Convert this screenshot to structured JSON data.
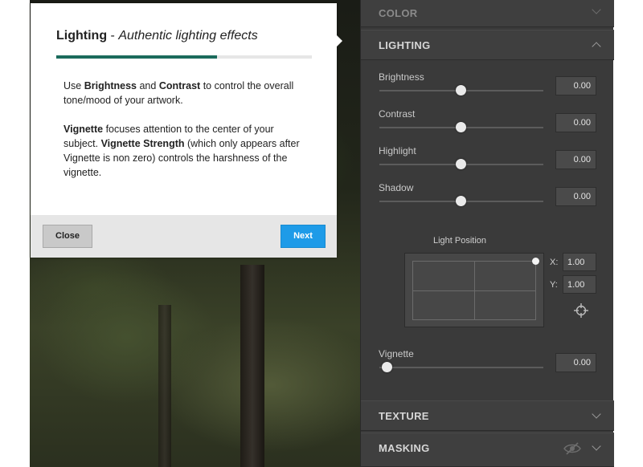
{
  "popover": {
    "title_bold": "Lighting",
    "title_sep": " - ",
    "title_italic": "Authentic lighting effects",
    "progress_fraction": 0.63,
    "p1": {
      "t1": "Use ",
      "b1": "Brightness",
      "t2": " and ",
      "b2": "Contrast",
      "t3": " to control the overall tone/mood of your artwork."
    },
    "p2": {
      "b1": "Vignette",
      "t1": " focuses attention to the center of your subject. ",
      "b2": "Vignette Strength",
      "t2": " (which only appears after Vignette is non zero) controls the harshness of the vignette."
    },
    "close_label": "Close",
    "next_label": "Next"
  },
  "panel": {
    "color_section": "COLOR",
    "lighting_section": "LIGHTING",
    "texture_section": "TEXTURE",
    "masking_section": "MASKING",
    "sliders": [
      {
        "label": "Brightness",
        "value": "0.00",
        "fraction": 0.5
      },
      {
        "label": "Contrast",
        "value": "0.00",
        "fraction": 0.5
      },
      {
        "label": "Highlight",
        "value": "0.00",
        "fraction": 0.5
      },
      {
        "label": "Shadow",
        "value": "0.00",
        "fraction": 0.5
      }
    ],
    "light_position": {
      "title": "Light Position",
      "x_label": "X:",
      "x_value": "1.00",
      "y_label": "Y:",
      "y_value": "1.00"
    },
    "vignette": {
      "label": "Vignette",
      "value": "0.00",
      "fraction": 0.0
    }
  },
  "icons": {
    "crosshair": "crosshair-icon",
    "visibility": "eye-slash-icon"
  },
  "colors": {
    "accent_progress": "#1b6b5c",
    "next_button": "#1e9be8",
    "panel_bg": "#3a3a3a"
  }
}
